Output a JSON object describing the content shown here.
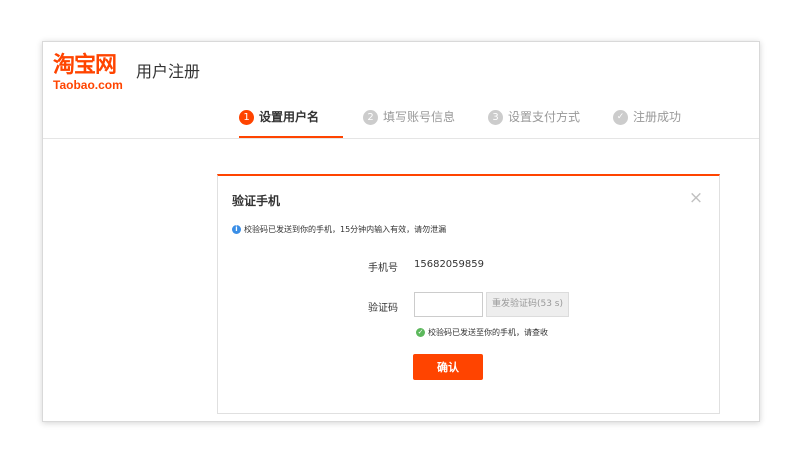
{
  "brand": {
    "logo_cn": "淘宝网",
    "logo_en": "Taobao.com",
    "page_title": "用户注册",
    "accent_color": "#ff4400"
  },
  "steps": [
    {
      "number": "1",
      "label": "设置用户名",
      "active": true
    },
    {
      "number": "2",
      "label": "填写账号信息",
      "active": false
    },
    {
      "number": "3",
      "label": "设置支付方式",
      "active": false
    },
    {
      "icon": "check-circle-icon",
      "label": "注册成功",
      "active": false
    }
  ],
  "dialog": {
    "title": "验证手机",
    "close_icon": "×",
    "notice": "校验码已发送到你的手机，15分钟内输入有效，请勿泄漏",
    "phone_label": "手机号",
    "phone_value": "15682059859",
    "code_label": "验证码",
    "code_value": "",
    "code_placeholder": "",
    "resend_label": "重发验证码(53 s)",
    "success_text": "校验码已发送至你的手机，请查收",
    "confirm_label": "确认"
  }
}
